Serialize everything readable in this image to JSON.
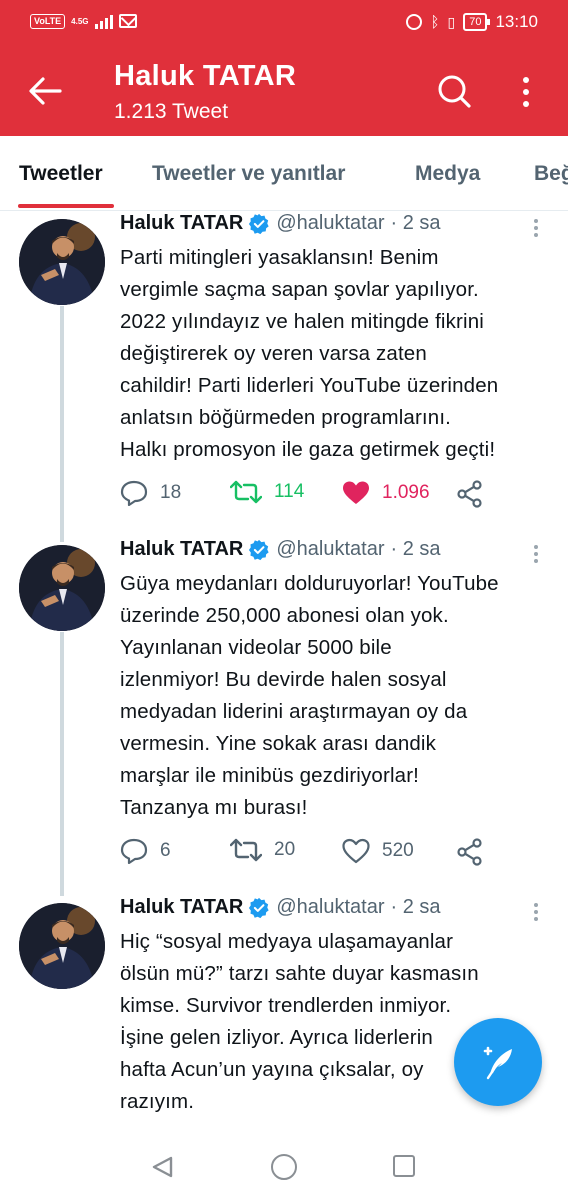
{
  "status_bar": {
    "volte": "VoLTE",
    "network": "4.5G",
    "battery": "70",
    "time": "13:10"
  },
  "header": {
    "title": "Haluk TATAR",
    "subtitle": "1.213 Tweet"
  },
  "tabs": [
    {
      "label": "Tweetler",
      "active": true
    },
    {
      "label": "Tweetler ve yanıtlar",
      "active": false
    },
    {
      "label": "Medya",
      "active": false
    },
    {
      "label": "Beğ",
      "active": false
    }
  ],
  "tweets": [
    {
      "name": "Haluk TATAR",
      "handle": "@haluktatar",
      "time": "· 2 sa",
      "lines": [
        "Parti mitingleri yasaklansın! Benim",
        "vergimle saçma sapan şovlar yapılıyor.",
        "2022 yılındayız ve halen mitingde fikrini",
        "değiştirerek oy veren varsa zaten",
        "cahildir! Parti liderleri YouTube üzerinden",
        "anlatsın böğürmeden programlarını.",
        "Halkı promosyon ile gaza getirmek geçti!"
      ],
      "replies": "18",
      "retweets": "114",
      "likes": "1.096",
      "retweeted": true,
      "liked": true
    },
    {
      "name": "Haluk TATAR",
      "handle": "@haluktatar",
      "time": "· 2 sa",
      "lines": [
        "Güya meydanları dolduruyorlar! YouTube",
        "üzerinde 250,000 abonesi olan yok.",
        "Yayınlanan videolar 5000 bile",
        "izlenmiyor! Bu devirde halen sosyal",
        "medyadan liderini araştırmayan oy da",
        "vermesin. Yine sokak arası dandik",
        "marşlar ile minibüs gezdiriyorlar!",
        "Tanzanya mı burası!"
      ],
      "replies": "6",
      "retweets": "20",
      "likes": "520",
      "retweeted": false,
      "liked": false
    },
    {
      "name": "Haluk TATAR",
      "handle": "@haluktatar",
      "time": "· 2 sa",
      "lines": [
        "Hiç “sosyal medyaya ulaşamayanlar",
        "ölsün mü?” tarzı sahte duyar kasmasın",
        "kimse. Survivor trendlerden inmiyor.",
        "İşine gelen izliyor. Ayrıca liderlerin",
        "hafta Acun’un yayına çıksalar, oy",
        "razıyım."
      ]
    }
  ],
  "colors": {
    "header_bg": "#e0303b",
    "retweet_active": "#17bf63",
    "like_active": "#e0245e",
    "fab": "#1d9bf0",
    "verified": "#1d9bf0"
  },
  "icons": {
    "back": "arrow-left-icon",
    "search": "search-icon",
    "more": "more-vertical-icon",
    "compose": "compose-feather-icon"
  }
}
